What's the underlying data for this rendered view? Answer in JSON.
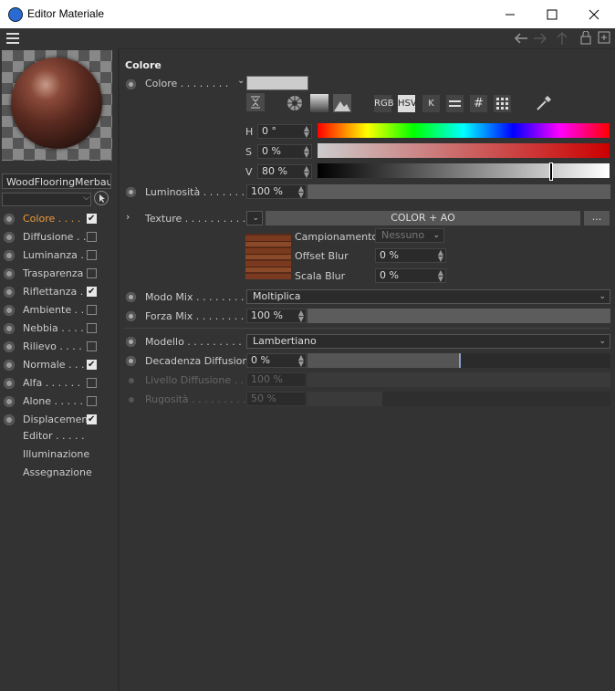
{
  "window": {
    "title": "Editor Materiale"
  },
  "toolbar": {
    "menu_icon": "hamburger-icon"
  },
  "material": {
    "name": "WoodFlooringMerbaul"
  },
  "channels": [
    {
      "label": "Colore . . . .",
      "checked": true,
      "active": true
    },
    {
      "label": "Diffusione . .",
      "checked": false
    },
    {
      "label": "Luminanza . .",
      "checked": false
    },
    {
      "label": "Trasparenza",
      "checked": false
    },
    {
      "label": "Riflettanza .",
      "checked": true
    },
    {
      "label": "Ambiente . .",
      "checked": false
    },
    {
      "label": "Nebbia . . . .",
      "checked": false
    },
    {
      "label": "Rilievo . . . .",
      "checked": false
    },
    {
      "label": "Normale . . .",
      "checked": true
    },
    {
      "label": "Alfa . . . . . .",
      "checked": false
    },
    {
      "label": "Alone . . . . .",
      "checked": false
    },
    {
      "label": "Displacement",
      "checked": true
    }
  ],
  "extra_items": [
    "Editor . . . . .",
    "Illuminazione",
    "Assegnazione"
  ],
  "section_title": "Colore",
  "color": {
    "label": "Colore . . . . . . . .",
    "mode_buttons": [
      "RGB",
      "HSV",
      "K"
    ],
    "h_label": "H",
    "h_value": "0 °",
    "s_label": "S",
    "s_value": "0 %",
    "v_label": "V",
    "v_value": "80 %",
    "v_level": 0.8
  },
  "luminosita": {
    "label": "Luminosità . . . . . . .",
    "value": "100 %",
    "level": 1.0
  },
  "texture": {
    "label": "Texture . . . . . . . . . .",
    "name": "COLOR + AO",
    "more": "...",
    "campionamento_label": "Campionamento",
    "campionamento_value": "Nessuno",
    "offset_blur_label": "Offset Blur",
    "offset_blur_value": "0 %",
    "scala_blur_label": "Scala Blur",
    "scala_blur_value": "0 %"
  },
  "modo_mix": {
    "label": "Modo Mix . . . . . . . .",
    "value": "Moltiplica"
  },
  "forza_mix": {
    "label": "Forza Mix . . . . . . . .",
    "value": "100 %",
    "level": 1.0
  },
  "modello": {
    "label": "Modello . . . . . . . . .",
    "value": "Lambertiano"
  },
  "decadenza": {
    "label": "Decadenza Diffusione",
    "value": "0 %",
    "level": 0.5
  },
  "livello": {
    "label": "Livello Diffusione . . .",
    "value": "100 %"
  },
  "rugosita": {
    "label": "Rugosità . . . . . . . . .",
    "value": "50 %"
  }
}
